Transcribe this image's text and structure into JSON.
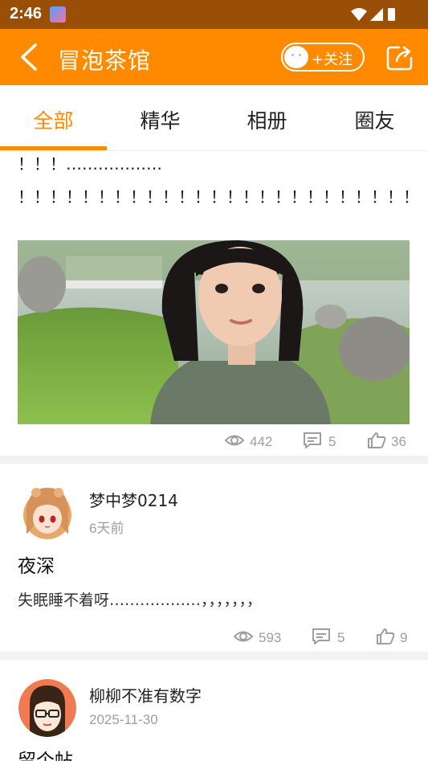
{
  "status_bar": {
    "time": "2:46"
  },
  "header": {
    "title": "冒泡茶馆",
    "follow_label": "+关注"
  },
  "tabs": [
    {
      "label": "全部",
      "active": true
    },
    {
      "label": "精华",
      "active": false
    },
    {
      "label": "相册",
      "active": false
    },
    {
      "label": "圈友",
      "active": false
    }
  ],
  "posts": [
    {
      "text_line1": "！！！………………",
      "text_line2": "！！！！！！！！！！！！！！！！！！！！！！！！！",
      "views": "442",
      "comments": "5",
      "likes": "36"
    },
    {
      "author": "梦中梦0214",
      "time": "6天前",
      "title": "夜深",
      "body": "失眠睡不着呀………………，，，，，，，",
      "views": "593",
      "comments": "5",
      "likes": "9"
    },
    {
      "author": "柳柳不准有数字",
      "time": "2025-11-30",
      "title": "留个帖"
    }
  ],
  "colors": {
    "accent": "#ff8a00",
    "status_bar": "#9a4f06",
    "muted": "#9e9e9e"
  }
}
